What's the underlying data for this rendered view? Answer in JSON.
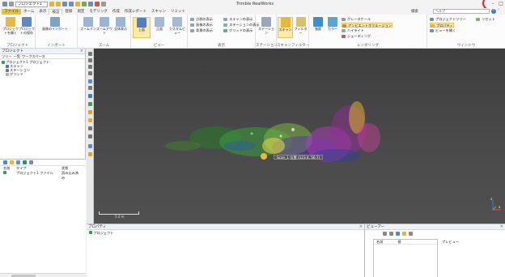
{
  "app": {
    "window_title": "Trimble RealWorks",
    "project_field": "プロジェクト1"
  },
  "ribbon": {
    "tabs": [
      "ファイル",
      "ホーム",
      "表示",
      "検証",
      "登録",
      "測定",
      "モデリング",
      "作成",
      "作成レポート",
      "スキャン",
      "リミット"
    ],
    "active_tab_index": 3,
    "search_label": "検索",
    "search_value": "ヘルプ",
    "help_glyph": "?",
    "groups": [
      {
        "label": "プロジェクト",
        "buttons": [
          "プロジェクトを開く",
          "プロジェクトの保存"
        ]
      },
      {
        "label": "インポート",
        "buttons": [
          "画像のインポート"
        ]
      },
      {
        "label": "ズーム",
        "buttons": [
          "ズームイン",
          "ズームアウト",
          "全体表示"
        ]
      },
      {
        "label": "ビュー",
        "buttons": [
          "上面",
          "正面",
          "カスタムビュー"
        ]
      },
      {
        "label": "表示",
        "buttons": [
          "点群の表示",
          "画像の表示",
          "背景の表示",
          "スキャンの表示",
          "ステーションの表示",
          "グリッドの表示"
        ]
      },
      {
        "label": "ステーション",
        "buttons": [
          "ステーション"
        ]
      },
      {
        "label": "スキャンフィルター",
        "buttons": [
          "スキャン",
          "フィルター"
        ]
      },
      {
        "label": "レンダリング",
        "buttons": [
          "強度",
          "カラー",
          "グレースケール",
          "アンビエントオクルージョン",
          "ハイライト",
          "シェーディング"
        ]
      },
      {
        "label": "ウィンドウ",
        "buttons": [
          "プロジェクトツリー",
          "プロパティ",
          "ビューを開く",
          "リセット"
        ]
      }
    ]
  },
  "left_panel": {
    "title": "プロジェクト",
    "tabs": [
      "ツリー",
      "一覧",
      "ワークスペース"
    ],
    "tree": [
      {
        "label": "プロジェクト1 プロジェクト",
        "level": 0
      },
      {
        "label": "スキャン",
        "level": 1
      },
      {
        "label": "ステーション",
        "level": 1
      },
      {
        "label": "グリッド",
        "level": 1
      }
    ]
  },
  "lower_left": {
    "columns": [
      "名前",
      "タイプ",
      "状態"
    ],
    "rows": [
      {
        "name": "プロジェクト1 ファイル",
        "type": "プロジェクトファイル",
        "status": "読み込み済み"
      }
    ]
  },
  "viewport": {
    "tooltip": "Scan_1  位置 (123.4, 56.7)",
    "scale_label": "5.0 m",
    "axis_labels": [
      "Z",
      "X"
    ]
  },
  "bottom": {
    "properties_title": "プロパティ",
    "properties_item": "プロジェクト",
    "preview_title": "ビューアー",
    "preview_columns": [
      "名前",
      "値"
    ],
    "preview_side_label": "プレビュー"
  },
  "colors": {
    "file_tab": "#e9c234",
    "viewport_bg": "#444444",
    "highlight": "#fde9a8",
    "help_ring": "#e02020"
  }
}
